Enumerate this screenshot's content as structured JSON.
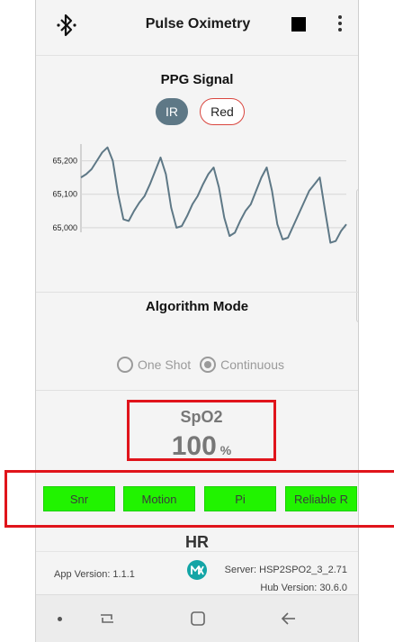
{
  "app_bar": {
    "title": "Pulse Oximetry",
    "bluetooth_icon": "bluetooth-icon",
    "stop_icon": "stop-icon",
    "more_icon": "more-vertical-icon"
  },
  "ppg": {
    "title": "PPG Signal",
    "toggle_ir": "IR",
    "toggle_red": "Red",
    "selected": "IR"
  },
  "chart_data": {
    "type": "line",
    "title": "",
    "xlabel": "",
    "ylabel": "",
    "yticks": [
      "65,200",
      "65,100",
      "65,000"
    ],
    "ylim": [
      64900,
      65250
    ],
    "series": [
      {
        "values": [
          65150,
          65160,
          65175,
          65200,
          65225,
          65240,
          65200,
          65100,
          65025,
          65020,
          65050,
          65075,
          65095,
          65130,
          65170,
          65210,
          65160,
          65060,
          65000,
          65005,
          65035,
          65070,
          65095,
          65130,
          65160,
          65180,
          65120,
          65030,
          64975,
          64985,
          65020,
          65050,
          65070,
          65110,
          65150,
          65180,
          65110,
          65010,
          64965,
          64970,
          65005,
          65040,
          65075,
          65110,
          65130,
          65150,
          65050,
          64955,
          64960,
          64990,
          65010
        ],
        "color": "#5e7886"
      }
    ],
    "grid": true
  },
  "algorithm": {
    "title": "Algorithm Mode",
    "option_one_shot": "One Shot",
    "option_continuous": "Continuous",
    "selected": "Continuous"
  },
  "spo2": {
    "label": "SpO2",
    "value": "100",
    "unit": "%"
  },
  "flags": {
    "snr": "Snr",
    "motion": "Motion",
    "pi": "Pi",
    "reliable_r": "Reliable R",
    "color": "#21f300"
  },
  "hr": {
    "label": "HR"
  },
  "footer": {
    "app_version": "App Version: 1.1.1",
    "server": "Server: HSP2SPO2_3_2.71",
    "hub_version": "Hub Version: 30.6.0"
  },
  "highlight_color": "#e0141b"
}
